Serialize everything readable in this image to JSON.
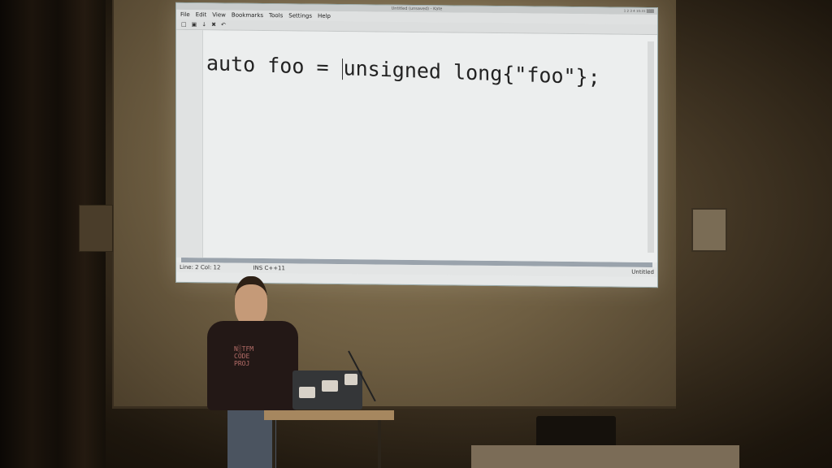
{
  "window": {
    "title": "Untitled (unsaved) - Kate",
    "tray": "1 2 3 4  10:31  ▒▒▒"
  },
  "menu": [
    "File",
    "Edit",
    "View",
    "Bookmarks",
    "Tools",
    "Settings",
    "Help"
  ],
  "toolbar": {
    "new": "□",
    "open": "▣",
    "save": "↓",
    "close": "✖",
    "undo": "↶"
  },
  "editor": {
    "code_before_cursor": "auto foo = ",
    "code_after_cursor": "unsigned long{\"foo\"};"
  },
  "status": {
    "position": "Line: 2 Col: 12",
    "mode": "INS  C++11",
    "document": "Untitled"
  },
  "presenter": {
    "shirt": "N░TFM\nCODE\nPROJ"
  }
}
